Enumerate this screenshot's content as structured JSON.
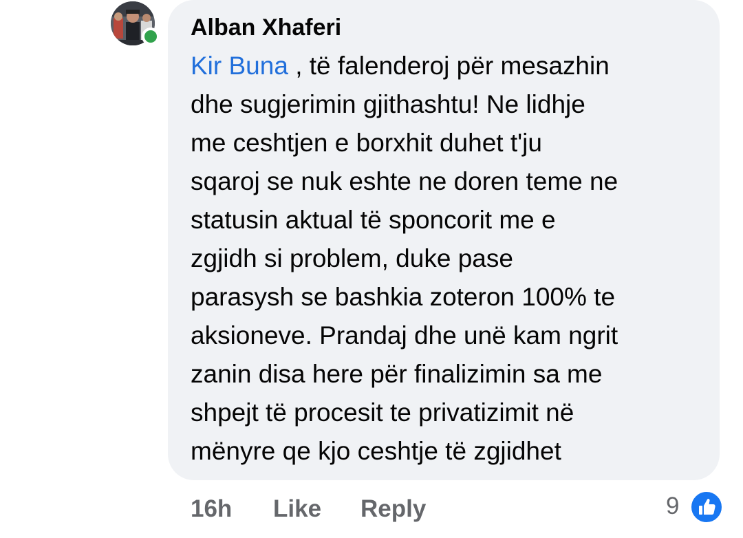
{
  "comment": {
    "author": "Alban Xhaferi",
    "mention": "Kir Buna",
    "text_lines": [
      " , të falenderoj për mesazhin",
      "dhe sugjerimin gjithashtu! Ne lidhje",
      "me ceshtjen e borxhit duhet t'ju",
      "sqaroj se nuk eshte ne doren teme ne",
      "statusin aktual të sponcorit me e",
      "zgjidh si problem, duke pase",
      "parasysh se bashkia zoteron 100% te",
      "aksioneve. Prandaj dhe unë kam ngrit",
      "zanin disa here për finalizimin sa me",
      "shpejt të procesit te privatizimit në",
      "mënyre qe kjo ceshtje të zgjidhet"
    ],
    "timestamp": "16h",
    "like_label": "Like",
    "reply_label": "Reply",
    "reaction_count": "9",
    "reaction_icon": "thumbs-up-icon",
    "online_status_color": "#31a24c",
    "mention_color": "#216fdb",
    "like_badge_color": "#1877f2"
  }
}
